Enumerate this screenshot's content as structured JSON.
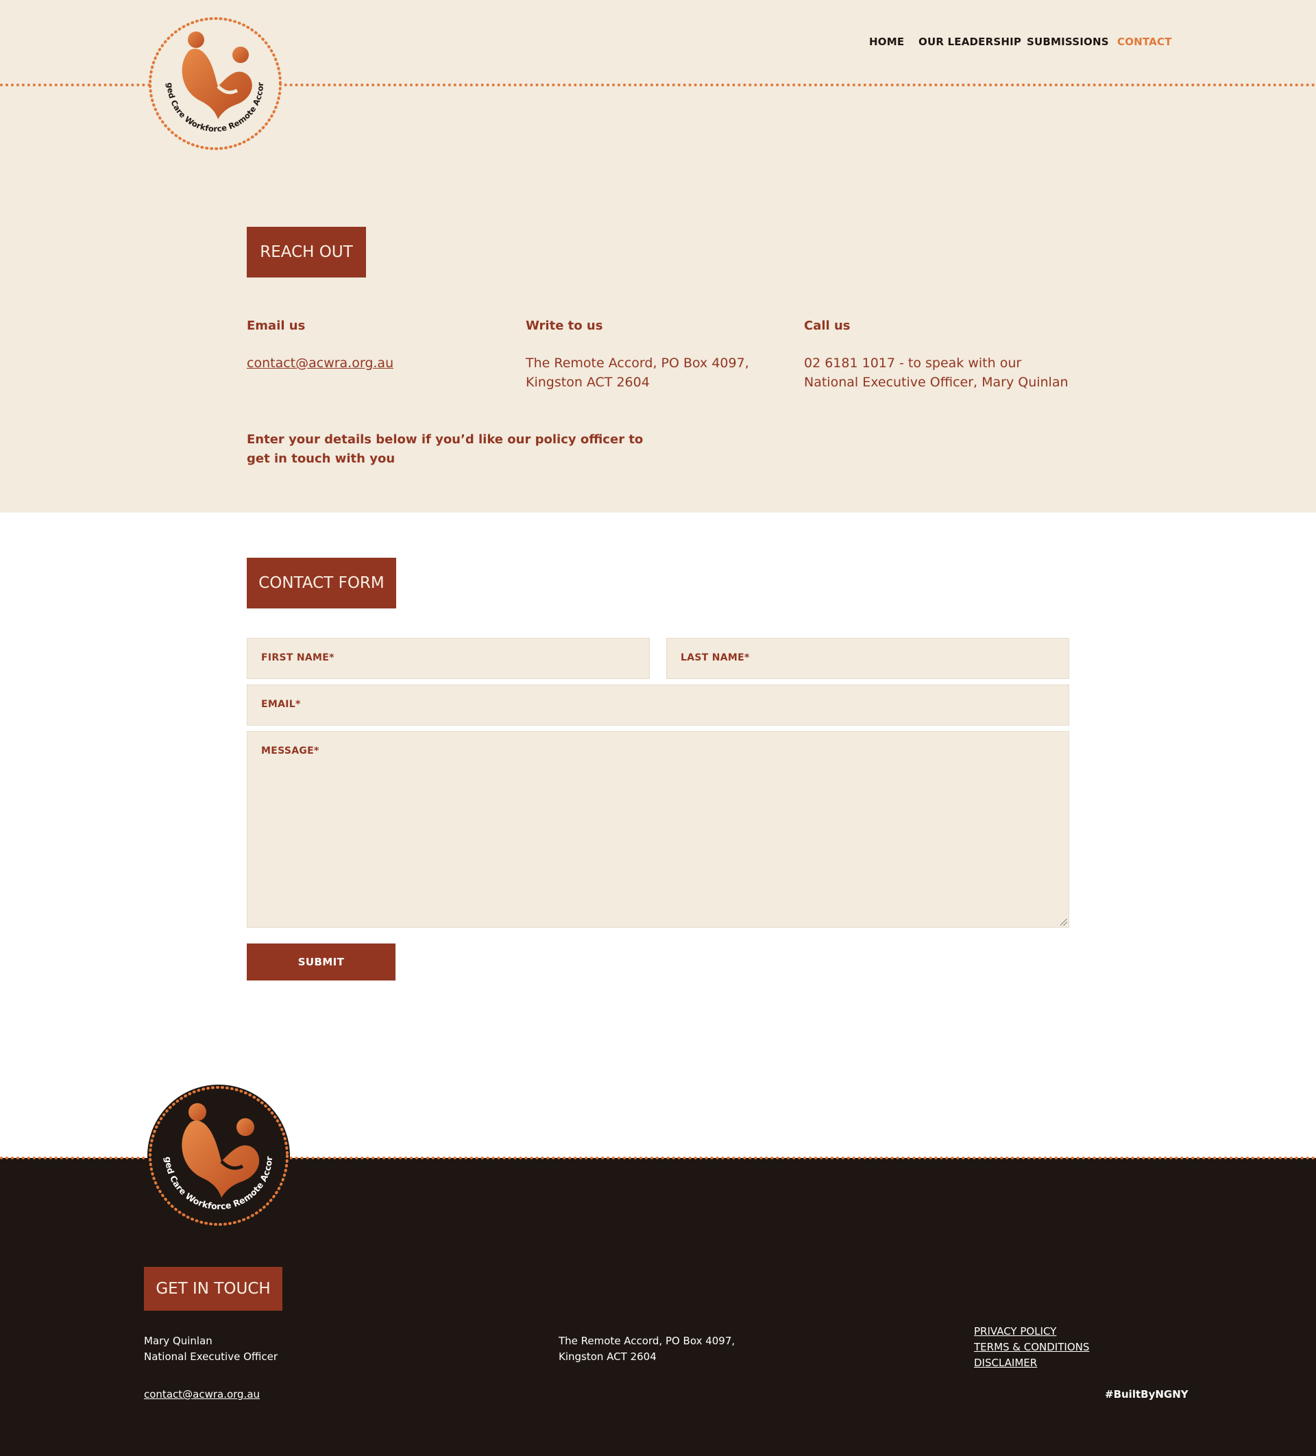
{
  "logo": {
    "text": "Aged Care Workforce Remote Accord"
  },
  "nav": {
    "items": [
      {
        "label": "HOME"
      },
      {
        "label": "OUR LEADERSHIP"
      },
      {
        "label": "SUBMISSIONS"
      },
      {
        "label": "CONTACT"
      }
    ],
    "active": "CONTACT"
  },
  "reach_out": {
    "heading": "REACH OUT",
    "columns": [
      {
        "title": "Email us",
        "text": "contact@acwra.org.au"
      },
      {
        "title": "Write to us",
        "text": "The Remote Accord, PO Box 4097, Kingston ACT 2604"
      },
      {
        "title": "Call us",
        "text": "02 6181 1017 - to speak with our National Executive Officer, Mary Quinlan"
      }
    ],
    "intro": "Enter your details below if you’d like our policy officer to get in touch with you"
  },
  "contact_form": {
    "heading": "CONTACT FORM",
    "first_name_placeholder": "FIRST NAME*",
    "last_name_placeholder": "LAST NAME*",
    "email_placeholder": "EMAIL*",
    "message_placeholder": "MESSAGE*",
    "submit_label": "SUBMIT"
  },
  "footer": {
    "heading": "GET IN TOUCH",
    "contact_name": "Mary Quinlan",
    "contact_role": "National Executive Officer",
    "email": "contact@acwra.org.au",
    "address_line1": "The Remote Accord, PO Box 4097,",
    "address_line2": "Kingston ACT 2604",
    "links": [
      "PRIVACY POLICY",
      "TERMS & CONDITIONS",
      "DISCLAIMER"
    ],
    "credit": "#BuiltByNGNY"
  },
  "colors": {
    "accent": "#e0793a",
    "brand_rust": "#923622",
    "cream": "#f2ebde",
    "footer_bg": "#1e1612"
  }
}
